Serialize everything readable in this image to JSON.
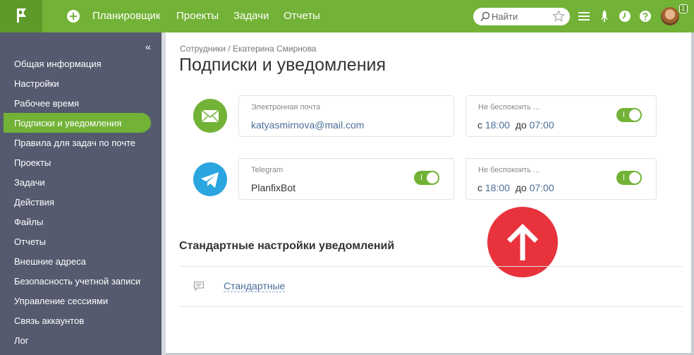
{
  "topbar": {
    "nav": [
      "Планировщик",
      "Проекты",
      "Задачи",
      "Отчеты"
    ],
    "search_placeholder": "Найти",
    "badge": "1"
  },
  "sidebar": {
    "collapse_glyph": "«",
    "items": [
      "Общая информация",
      "Настройки",
      "Рабочее время",
      "Подписки и уведомления",
      "Правила для задач по почте",
      "Проекты",
      "Задачи",
      "Действия",
      "Файлы",
      "Отчеты",
      "Внешние адреса",
      "Безопасность учетной записи",
      "Управление сессиями",
      "Связь аккаунтов",
      "Лог"
    ],
    "active_index": 3
  },
  "breadcrumb": "Сотрудники / Екатерина Смирнова",
  "page_title": "Подписки и уведомления",
  "email": {
    "label": "Электронная почта",
    "value": "katyasmirnova@mail.com",
    "dnd_label": "Не беспокоить ...",
    "from_word": "с",
    "from_time": "18:00",
    "to_word": "до",
    "to_time": "07:00",
    "dnd_enabled": true
  },
  "telegram": {
    "label": "Telegram",
    "value": "PlanfixBot",
    "enabled": true,
    "dnd_label": "Не беспокоить ...",
    "from_word": "с",
    "from_time": "18:00",
    "to_word": "до",
    "to_time": "07:00",
    "dnd_enabled": true
  },
  "section_title": "Стандартные настройки уведомлений",
  "standard_link": "Стандартные",
  "colors": {
    "accent": "#72b236",
    "sidebar": "#555a6f",
    "telegram": "#2aa5e0",
    "arrow": "#e8323c",
    "link": "#4b6e99"
  }
}
